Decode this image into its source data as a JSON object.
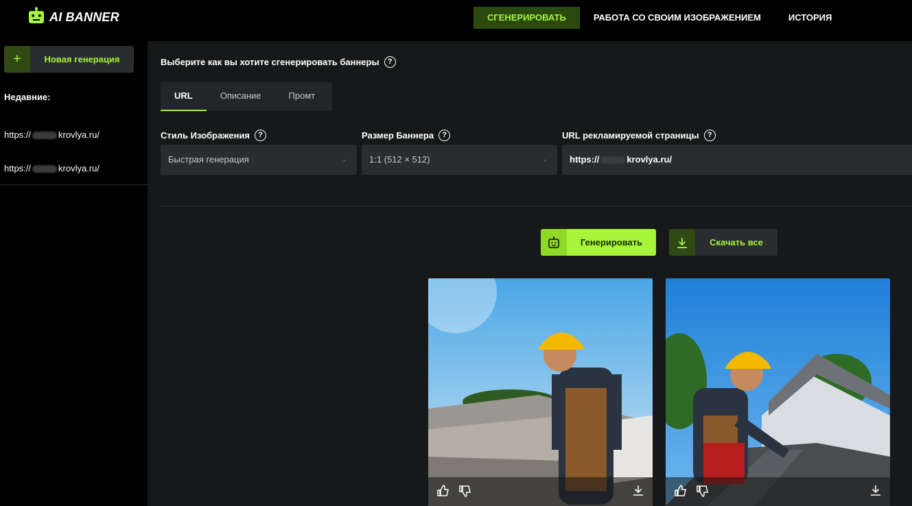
{
  "app": {
    "logo_text": "AI BANNER"
  },
  "nav": [
    {
      "label": "СГЕНЕРИРОВАТЬ",
      "active": true
    },
    {
      "label": "РАБОТА СО СВОИМ ИЗОБРАЖЕНИЕМ",
      "active": false
    },
    {
      "label": "ИСТОРИЯ",
      "active": false
    }
  ],
  "sidebar": {
    "new_button": "Новая генерация",
    "recent_title": "Недавние:",
    "recent": [
      {
        "prefix": "https://",
        "suffix": "krovlya.ru/"
      },
      {
        "prefix": "https://",
        "suffix": "krovlya.ru/"
      }
    ]
  },
  "main": {
    "question": "Выберите как вы хотите сгенерировать баннеры",
    "tabs": [
      {
        "label": "URL",
        "active": true
      },
      {
        "label": "Описание",
        "active": false
      },
      {
        "label": "Промт",
        "active": false
      }
    ],
    "fields": {
      "style_label": "Стиль Изображения",
      "style_value": "Быстрая генерация",
      "size_label": "Размер Баннера",
      "size_value": "1:1 (512 × 512)",
      "url_label": "URL рекламируемой страницы",
      "url_prefix": "https://",
      "url_suffix": "krovlya.ru/"
    },
    "generate_button": "Генерировать",
    "download_all_button": "Скачать все"
  },
  "colors": {
    "accent": "#a6f53a",
    "accent_dark": "#2f4a14",
    "bg": "#161819",
    "panel": "#2a2d2f"
  },
  "icons": [
    "robot-icon",
    "plus-icon",
    "help-icon",
    "chevron-down-icon",
    "download-icon",
    "thumbs-up-icon",
    "thumbs-down-icon"
  ]
}
